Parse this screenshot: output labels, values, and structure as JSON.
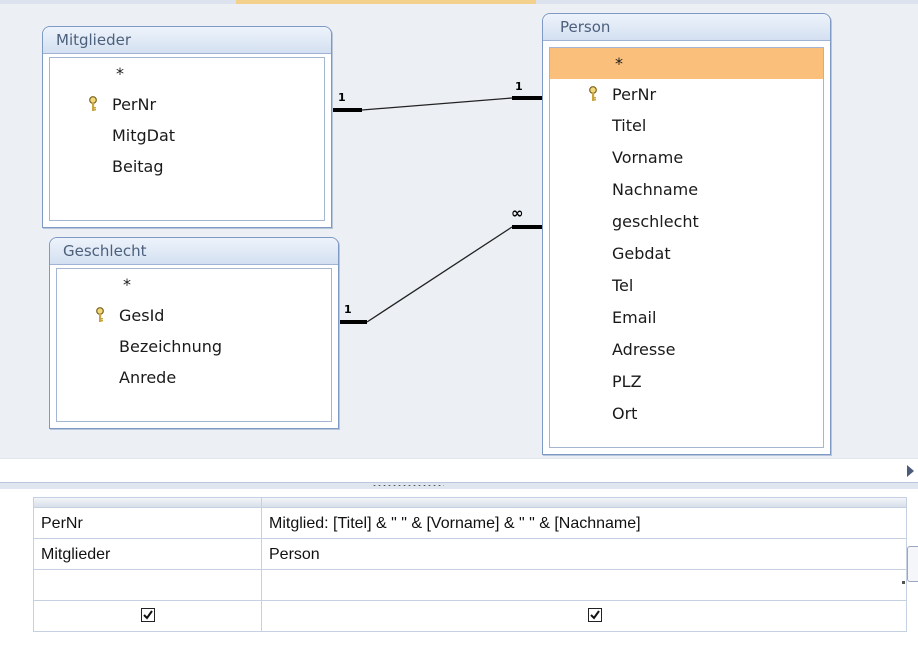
{
  "relationships_pane": {
    "tables": [
      {
        "title": "Mitglieder",
        "fields": [
          {
            "name": "*",
            "key": false
          },
          {
            "name": "PerNr",
            "key": true
          },
          {
            "name": "MitgDat",
            "key": false
          },
          {
            "name": "Beitag",
            "key": false
          }
        ]
      },
      {
        "title": "Geschlecht",
        "fields": [
          {
            "name": "*",
            "key": false
          },
          {
            "name": "GesId",
            "key": true
          },
          {
            "name": "Bezeichnung",
            "key": false
          },
          {
            "name": "Anrede",
            "key": false
          }
        ]
      },
      {
        "title": "Person",
        "fields": [
          {
            "name": "*",
            "key": false,
            "selected": true
          },
          {
            "name": "PerNr",
            "key": true
          },
          {
            "name": "Titel",
            "key": false
          },
          {
            "name": "Vorname",
            "key": false
          },
          {
            "name": "Nachname",
            "key": false
          },
          {
            "name": "geschlecht",
            "key": false
          },
          {
            "name": "Gebdat",
            "key": false
          },
          {
            "name": "Tel",
            "key": false
          },
          {
            "name": "Email",
            "key": false
          },
          {
            "name": "Adresse",
            "key": false
          },
          {
            "name": "PLZ",
            "key": false
          },
          {
            "name": "Ort",
            "key": false
          }
        ]
      }
    ],
    "relations": [
      {
        "from": "Mitglieder",
        "to": "Person",
        "from_card": "1",
        "to_card": "1"
      },
      {
        "from": "Geschlecht",
        "to": "Person",
        "from_card": "1",
        "to_card": "∞"
      }
    ],
    "colors": {
      "selected_field": "#fbbf7c",
      "title_text": "#4c607c",
      "border": "#7d99c4"
    }
  },
  "design_grid": {
    "columns": [
      {
        "field": "PerNr",
        "table": "Mitglieder",
        "show": true
      },
      {
        "field": "Mitglied: [Titel] & \" \" & [Vorname] & \" \" & [Nachname]",
        "table": "Person",
        "show": true
      }
    ]
  }
}
